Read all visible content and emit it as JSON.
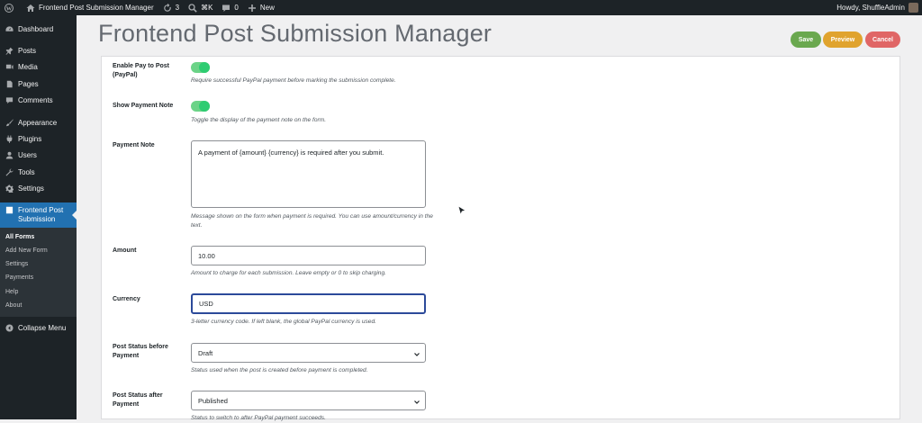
{
  "adminbar": {
    "site_name": "Frontend Post Submission Manager",
    "updates_count": "3",
    "command_shortcut": "⌘K",
    "comments_count": "0",
    "new_label": "New",
    "howdy": "Howdy, ShuffleAdmin"
  },
  "sidebar": {
    "items": [
      {
        "label": "Dashboard",
        "icon": "dashboard-icon"
      },
      {
        "label": "Posts",
        "icon": "pin-icon"
      },
      {
        "label": "Media",
        "icon": "media-icon"
      },
      {
        "label": "Pages",
        "icon": "pages-icon"
      },
      {
        "label": "Comments",
        "icon": "comment-icon"
      },
      {
        "label": "Appearance",
        "icon": "brush-icon"
      },
      {
        "label": "Plugins",
        "icon": "plug-icon"
      },
      {
        "label": "Users",
        "icon": "user-icon"
      },
      {
        "label": "Tools",
        "icon": "wrench-icon"
      },
      {
        "label": "Settings",
        "icon": "settings-icon"
      }
    ],
    "current": {
      "label": "Frontend Post Submission",
      "icon": "form-icon"
    },
    "submenu": [
      "All Forms",
      "Add New Form",
      "Settings",
      "Payments",
      "Help",
      "About"
    ],
    "collapse_label": "Collapse Menu"
  },
  "page": {
    "title": "Frontend Post Submission Manager",
    "save_label": "Save",
    "preview_label": "Preview",
    "cancel_label": "Cancel"
  },
  "form": {
    "enable_pay": {
      "label": "Enable Pay to Post (PayPal)",
      "enabled": true,
      "description": "Require successful PayPal payment before marking the submission complete."
    },
    "show_note": {
      "label": "Show Payment Note",
      "enabled": true,
      "description": "Toggle the display of the payment note on the form."
    },
    "payment_note": {
      "label": "Payment Note",
      "value": "A payment of {amount} {currency} is required after you submit.",
      "description": "Message shown on the form when payment is required. You can use amount/currency in the text."
    },
    "amount": {
      "label": "Amount",
      "value": "10.00",
      "description": "Amount to charge for each submission. Leave empty or 0 to skip charging."
    },
    "currency": {
      "label": "Currency",
      "value": "USD",
      "description": "3-letter currency code. If left blank, the global PayPal currency is used."
    },
    "status_before": {
      "label": "Post Status before Payment",
      "value": "Draft",
      "description": "Status used when the post is created before payment is completed."
    },
    "status_after": {
      "label": "Post Status after Payment",
      "value": "Published",
      "description": "Status to switch to after PayPal payment succeeds."
    }
  },
  "colors": {
    "accent": "#2271b1",
    "toggle_on": "#2ecc71",
    "save": "#6aa84f",
    "preview": "#e0a32e",
    "cancel": "#e06666"
  }
}
